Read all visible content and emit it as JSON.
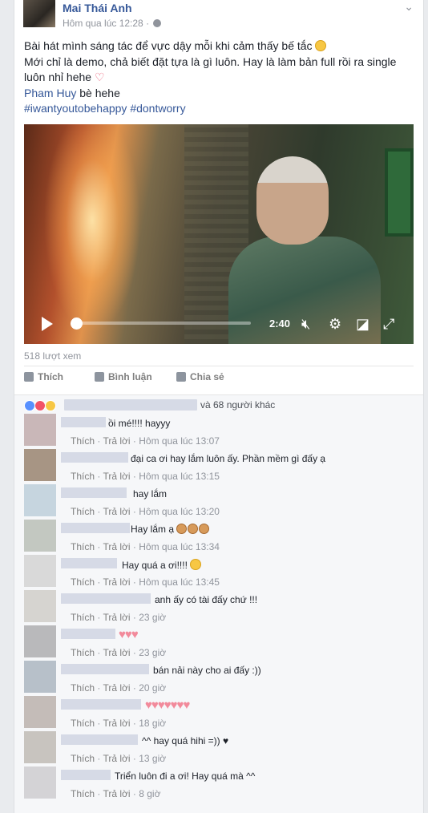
{
  "post": {
    "author": "Mai Thái Anh",
    "time": "Hôm qua lúc 12:28 · ",
    "line1": "Bài hát mình sáng tác để vực dậy mỗi khi cảm thấy bế tắc ",
    "line2": "Mới chỉ là demo, chả biết đặt tựa là gì luôn. Hay là làm bản full rồi ra single luôn nhỉ hehe ",
    "tag_name": "Pham Huy",
    "tag_rest": " bè hehe",
    "hashtags": "#iwantyoutobehappy #dontworry"
  },
  "video": {
    "time": "2:40",
    "views": "518 lượt xem"
  },
  "actions": {
    "like": "Thích",
    "comment": "Bình luận",
    "share": "Chia sẻ"
  },
  "reactions": {
    "others": "và 68 người khác"
  },
  "comment_meta": {
    "like": "Thích",
    "reply": "Trả lời",
    "sep": " · "
  },
  "comments": [
    {
      "text": "ồi mé!!!! hayyy",
      "time": "Hôm qua lúc 13:07",
      "avatar": "#c9b7b8"
    },
    {
      "text": "đại ca ơi hay lắm luôn ấy. Phần mềm gì đấy ạ",
      "time": "Hôm qua lúc 13:15",
      "avatar": "#a79584"
    },
    {
      "text": "hay lắm",
      "time": "Hôm qua lúc 13:20",
      "avatar": "#c6d5df"
    },
    {
      "text": "Hay lắm ạ ",
      "time": "Hôm qua lúc 13:34",
      "avatar": "#c3c8c1"
    },
    {
      "text": "Hay quá a ơi!!!! ",
      "time": "Hôm qua lúc 13:45",
      "avatar": "#d9d9d9"
    },
    {
      "text": "anh ấy có tài đấy chứ !!!",
      "time": "23 giờ",
      "avatar": "#d6d4d0"
    },
    {
      "text": "♥♥♥",
      "time": "23 giờ",
      "avatar": "#b9b9bb"
    },
    {
      "text": "bán nải này cho ai đấy :))",
      "time": "20 giờ",
      "avatar": "#b7c0c9"
    },
    {
      "text": "♥♥♥♥♥♥♥",
      "time": "18 giờ",
      "avatar": "#c4bcb8"
    },
    {
      "text": "^^ hay quá hihi =)) ♥",
      "time": "13 giờ",
      "avatar": "#c8c4bf"
    },
    {
      "text": "Triển luôn đi a ơi! Hay quá mà ^^",
      "time": "8 giờ",
      "avatar": "#d4d3d6"
    }
  ],
  "colors": {
    "link": "#365899",
    "meta": "#90949c",
    "heart": "#f28a9b",
    "like_blue": "#5890ff"
  }
}
